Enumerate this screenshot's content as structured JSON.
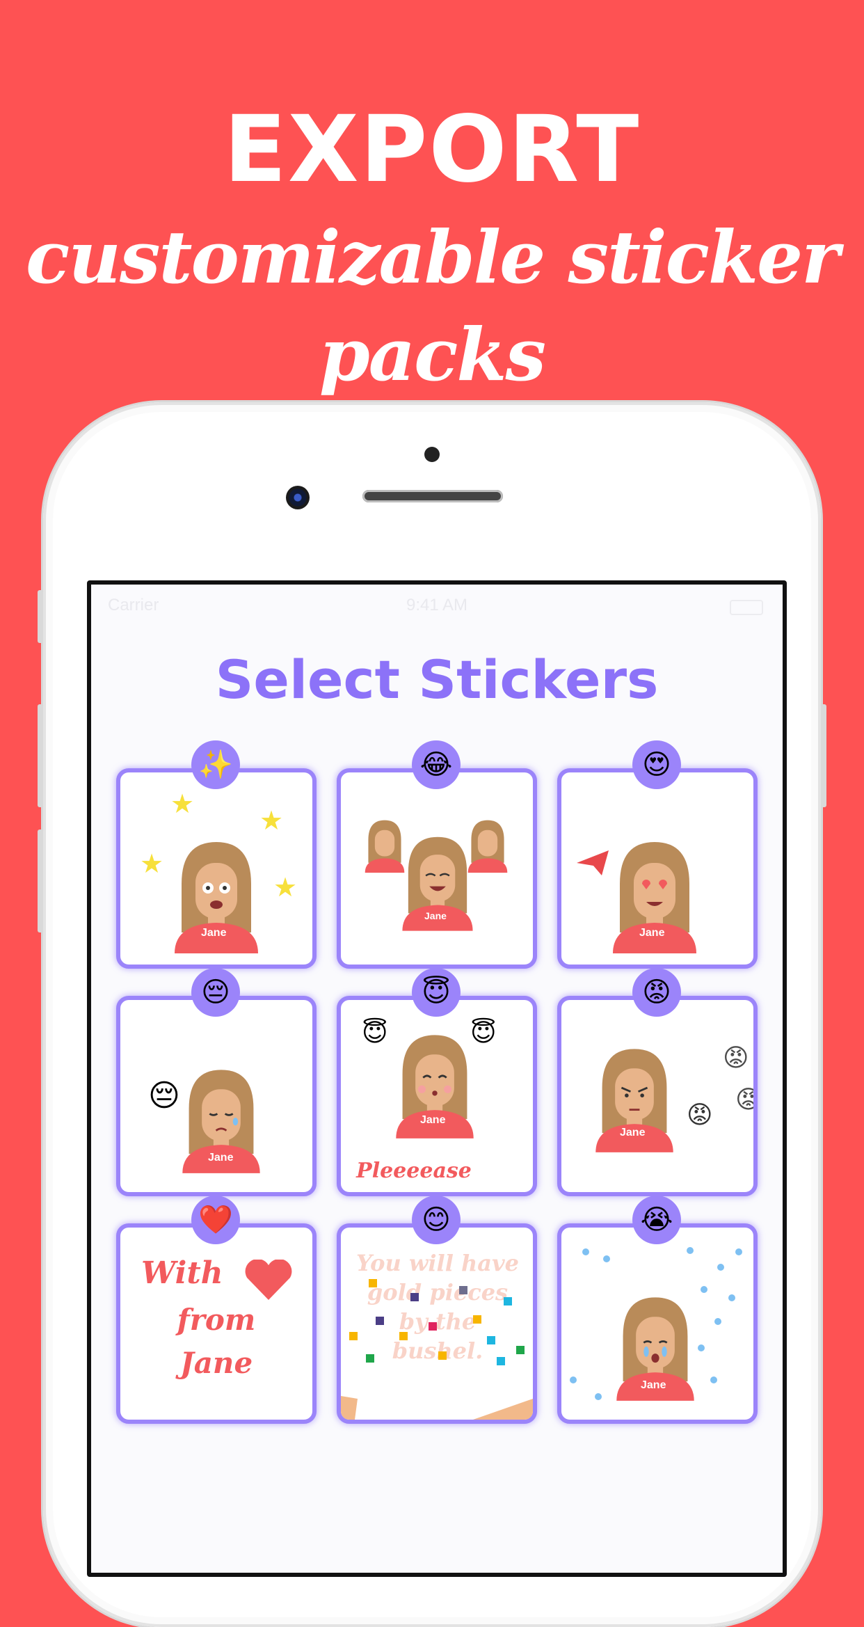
{
  "header": {
    "headline": "EXPORT",
    "subline": "customizable sticker packs"
  },
  "status_bar": {
    "carrier": "Carrier",
    "time": "9:41 AM"
  },
  "screen": {
    "title": "Select Stickers"
  },
  "stickers": [
    {
      "badge": "✨",
      "name_tag": "Jane"
    },
    {
      "badge": "😂",
      "name_tag": "Jane"
    },
    {
      "badge": "😍",
      "name_tag": "Jane"
    },
    {
      "badge": "😔",
      "name_tag": "Jane"
    },
    {
      "badge": "😇",
      "name_tag": "Jane",
      "caption": "Pleeeease"
    },
    {
      "badge": "😡",
      "name_tag": "Jane"
    },
    {
      "badge": "❤️",
      "caption_line1": "With",
      "caption_line2": "from",
      "caption_line3": "Jane"
    },
    {
      "badge": "😊",
      "caption": "You will have gold pieces by the bushel."
    },
    {
      "badge": "😭",
      "name_tag": "Jane"
    }
  ],
  "colors": {
    "background": "#FE5253",
    "accent_purple": "#8C72F8",
    "tile_border": "#9B84FA",
    "shirt": "#F25A5D",
    "hair": "#B98B59",
    "skin": "#E8B48A"
  }
}
